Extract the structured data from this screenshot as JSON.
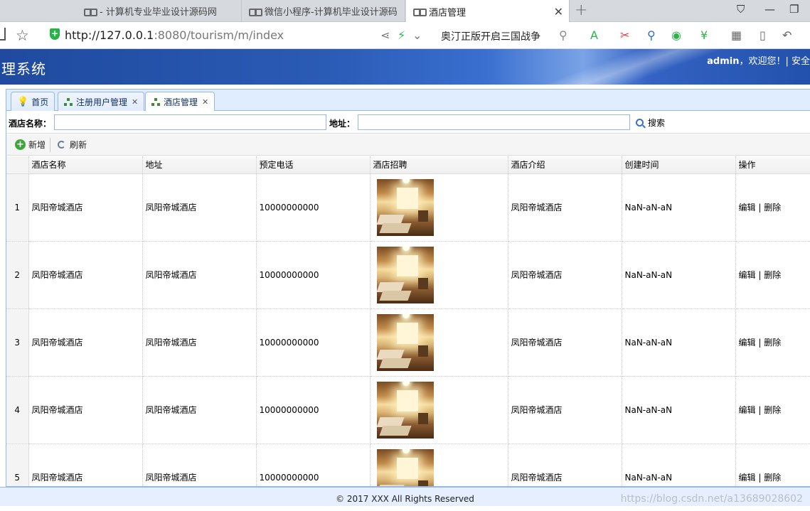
{
  "browser": {
    "tabs": [
      {
        "title": "- 计算机专业毕业设计源码网"
      },
      {
        "title": "微信小程序-计算机毕业设计源码"
      },
      {
        "title": "酒店管理"
      }
    ],
    "url_host": "http://127.0.0.1",
    "url_rest": ":8080/tourism/m/index",
    "search_text": "奥汀正版开启三国战争"
  },
  "header": {
    "title": "理系统",
    "user": "admin",
    "welcome": "，欢迎您！| 安全"
  },
  "panel_tabs": [
    {
      "label": "首页",
      "icon": "lightbulb-icon",
      "closable": false
    },
    {
      "label": "注册用户管理",
      "icon": "tree-icon",
      "closable": true
    },
    {
      "label": "酒店管理",
      "icon": "tree-icon",
      "closable": true
    }
  ],
  "search": {
    "name_label": "酒店名称：",
    "addr_label": "地址：",
    "button_label": "搜索",
    "name_value": "",
    "addr_value": ""
  },
  "toolbar": {
    "add_label": "新增",
    "refresh_label": "刷新"
  },
  "grid": {
    "columns": [
      "酒店名称",
      "地址",
      "预定电话",
      "酒店招聘",
      "酒店介绍",
      "创建时间",
      "操作"
    ],
    "rows": [
      {
        "no": "1",
        "name": "凤阳帝城酒店",
        "address": "凤阳帝城酒店",
        "phone": "10000000000",
        "intro": "凤阳帝城酒店",
        "created": "NaN-aN-aN",
        "edit": "编辑",
        "sep": "|",
        "del": "删除"
      },
      {
        "no": "2",
        "name": "凤阳帝城酒店",
        "address": "凤阳帝城酒店",
        "phone": "10000000000",
        "intro": "凤阳帝城酒店",
        "created": "NaN-aN-aN",
        "edit": "编辑",
        "sep": "|",
        "del": "删除"
      },
      {
        "no": "3",
        "name": "凤阳帝城酒店",
        "address": "凤阳帝城酒店",
        "phone": "10000000000",
        "intro": "凤阳帝城酒店",
        "created": "NaN-aN-aN",
        "edit": "编辑",
        "sep": "|",
        "del": "删除"
      },
      {
        "no": "4",
        "name": "凤阳帝城酒店",
        "address": "凤阳帝城酒店",
        "phone": "10000000000",
        "intro": "凤阳帝城酒店",
        "created": "NaN-aN-aN",
        "edit": "编辑",
        "sep": "|",
        "del": "删除"
      },
      {
        "no": "5",
        "name": "凤阳帝城酒店",
        "address": "凤阳帝城酒店",
        "phone": "10000000000",
        "intro": "凤阳帝城酒店",
        "created": "NaN-aN-aN",
        "edit": "编辑",
        "sep": "|",
        "del": "删除"
      }
    ]
  },
  "footer": {
    "copyright": "© 2017 XXX All Rights Reserved",
    "watermark": "https://blog.csdn.net/a13689028602"
  }
}
